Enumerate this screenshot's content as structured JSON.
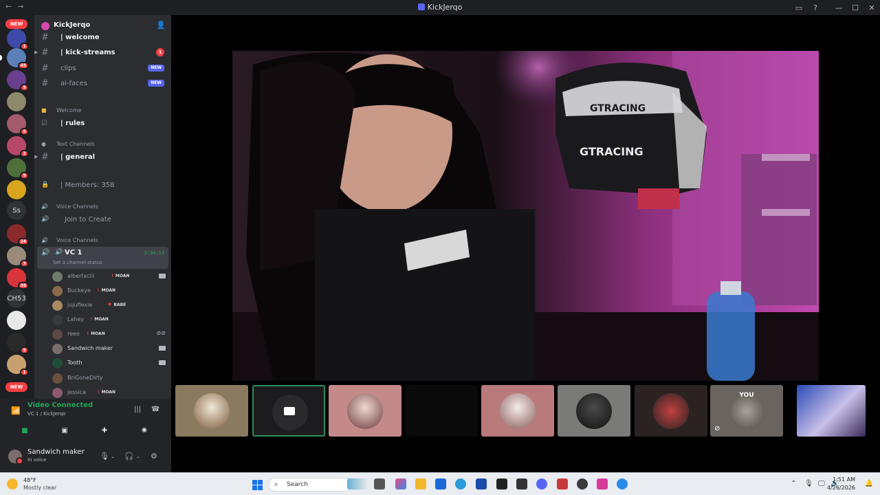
{
  "window": {
    "title": "KickJerqo",
    "nav_back": "←",
    "nav_forward": "→"
  },
  "rail": {
    "new_top": "NEW",
    "new_bottom": "NEW",
    "badges": [
      "1",
      "45",
      "5",
      "6",
      "2",
      "9",
      "24",
      "3",
      "36",
      "53",
      "9",
      "1"
    ],
    "text_servers": [
      "Ss",
      "CH"
    ]
  },
  "server": {
    "name": "KickJerqo",
    "channels": [
      {
        "label": "| welcome"
      },
      {
        "label": "| kick-streams",
        "badge": "1"
      },
      {
        "label": "clips",
        "tag": "NEW"
      },
      {
        "label": "ai-faces",
        "tag": "NEW"
      }
    ],
    "welcome_category": "Welcome",
    "rules": "| rules",
    "text_category": "Text Channels",
    "general": "| general",
    "members": "| Members: 358",
    "voice_category_1": "Voice Channels",
    "join_to_create": "Join to Create",
    "voice_category_2": "Voice Channels",
    "vc": {
      "name": "VC 1",
      "timer": "3:34:14",
      "status": "Set a channel status"
    },
    "voice_members": [
      {
        "name": "albertxciii",
        "role": "MOAN",
        "color": "#6d7b6a"
      },
      {
        "name": "Buckeye",
        "role": "MOAN",
        "color": "#8a6a4a"
      },
      {
        "name": "jujuflexie",
        "role": "BABE",
        "color": "#a88b62"
      },
      {
        "name": "Lahey",
        "role": "MOAN",
        "color": "#3a3a3a"
      },
      {
        "name": "reee",
        "role": "MOAN",
        "color": "#5a4a46"
      },
      {
        "name": "Sandwich maker",
        "role": "",
        "color": "#7a6f6c"
      },
      {
        "name": "Tooth",
        "role": "",
        "color": "#1f4d3a"
      },
      {
        "name": "BriGoneDirty",
        "role": "",
        "color": "#6a5040"
      },
      {
        "name": "jessica",
        "role": "MOAN",
        "color": "#8a5a6a"
      }
    ]
  },
  "voice_panel": {
    "title": "Video Connected",
    "subtitle": "VC 1 / KickJerqo"
  },
  "user": {
    "name": "Sandwich maker",
    "status": "In voice"
  },
  "stage": {
    "chair_text": "GTRACING",
    "tile_you": "YOU"
  },
  "taskbar": {
    "temp": "48°F",
    "weather": "Mostly clear",
    "search": "Search",
    "time": "1:51 AM",
    "date": "4/26/2026"
  }
}
